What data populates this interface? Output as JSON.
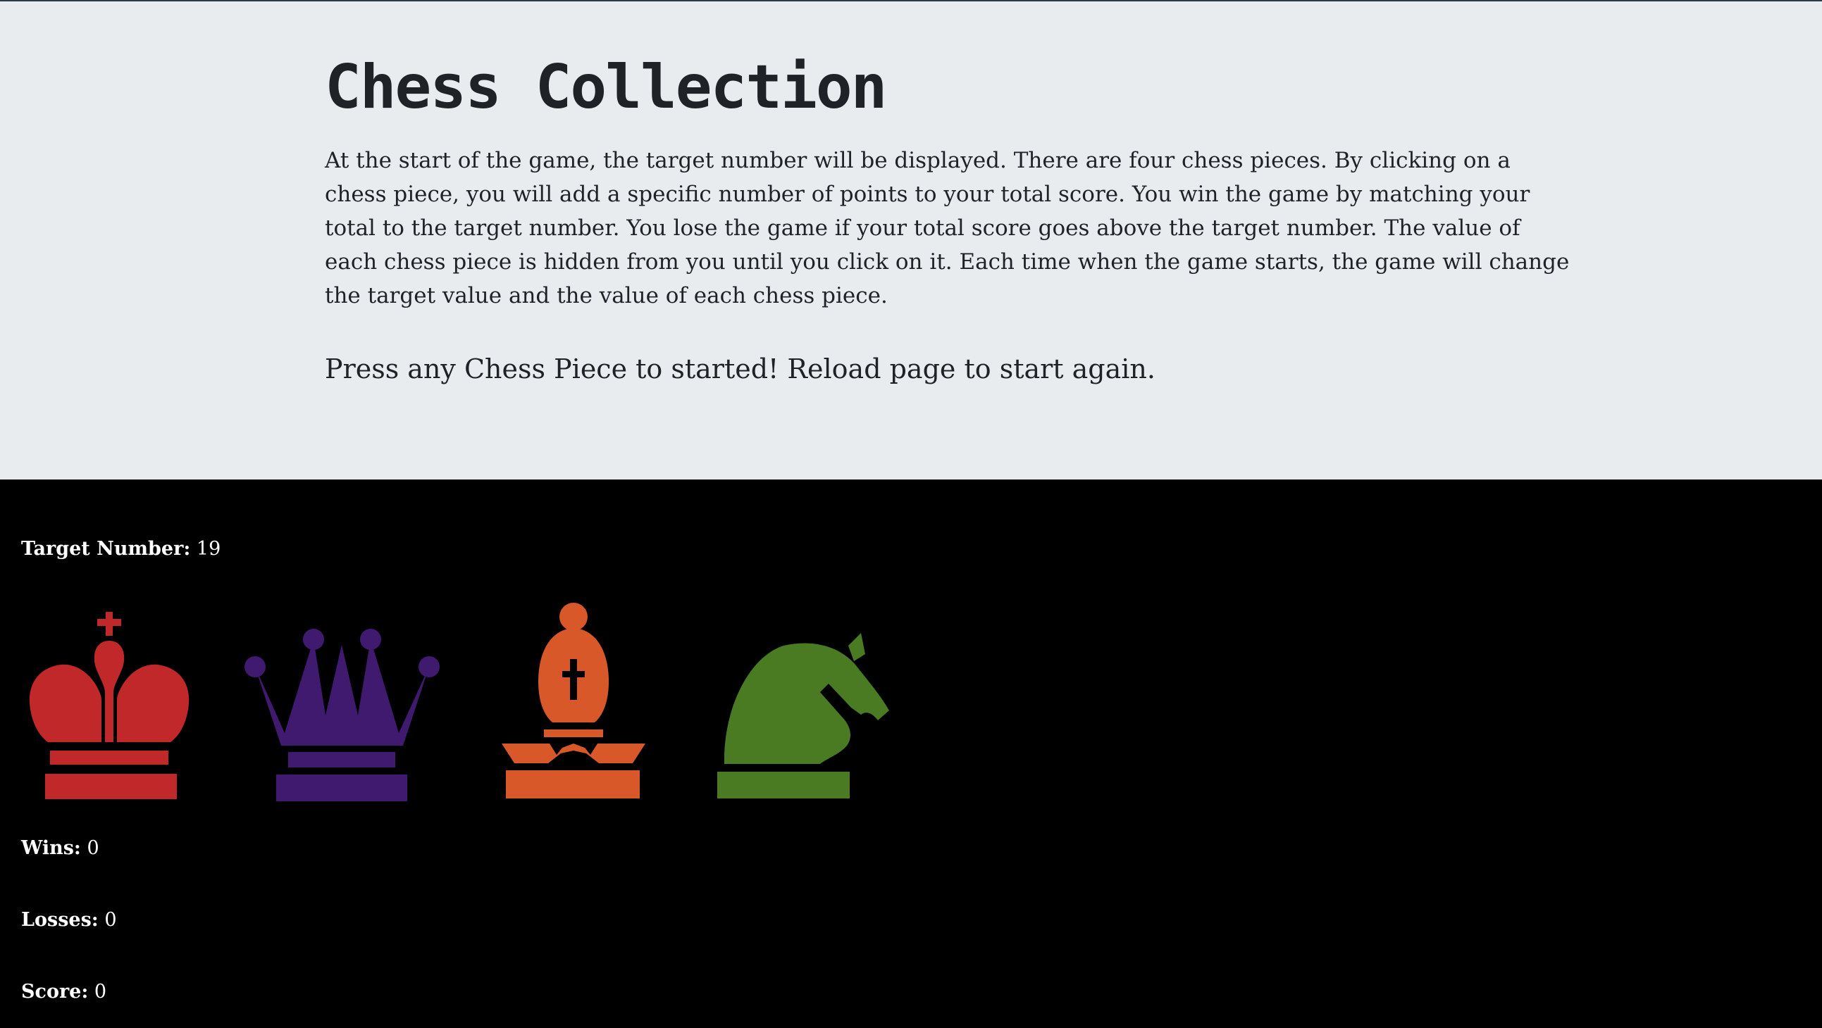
{
  "header": {
    "title": "Chess Collection",
    "instructions": "At the start of the game, the target number will be displayed. There are four chess pieces. By clicking on a chess piece, you will add a specific number of points to your total score. You win the game by matching your total to the target number. You lose the game if your total score goes above the target number. The value of each chess piece is hidden from you until you click on it. Each time when the game starts, the game will change the target value and the value of each chess piece.",
    "start_message": "Press any Chess Piece to started! Reload page to start again."
  },
  "game": {
    "target_label": "Target Number:",
    "target_value": "19",
    "wins_label": "Wins:",
    "wins_value": "0",
    "losses_label": "Losses:",
    "losses_value": "0",
    "score_label": "Score:",
    "score_value": "0"
  },
  "pieces": [
    {
      "icon": "king-icon",
      "color": "#c0282a"
    },
    {
      "icon": "queen-icon",
      "color": "#401a6e"
    },
    {
      "icon": "bishop-icon",
      "color": "#d9582a"
    },
    {
      "icon": "knight-icon",
      "color": "#4a7a22"
    }
  ],
  "colors": {
    "jumbotron_bg": "#e9ecef",
    "game_bg": "#000000",
    "text_dark": "#1f2327",
    "text_light": "#ffffff"
  }
}
